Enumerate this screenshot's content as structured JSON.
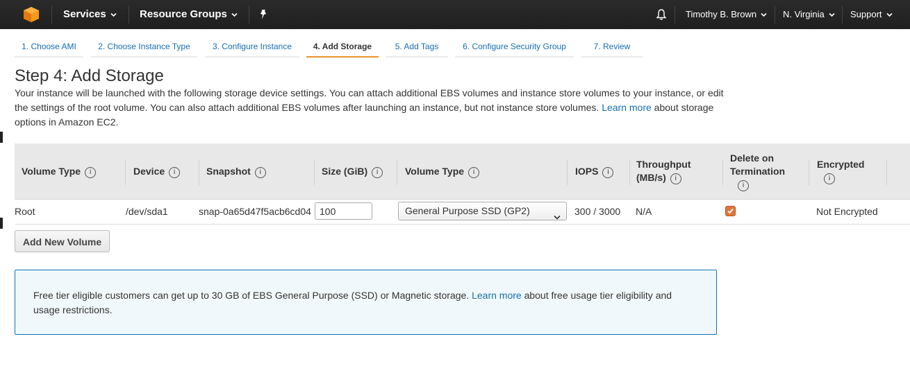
{
  "nav": {
    "services": "Services",
    "resource_groups": "Resource Groups",
    "user": "Timothy B. Brown",
    "region": "N. Virginia",
    "support": "Support",
    "logo_icon": "aws-cube-icon",
    "pin_icon": "pin-icon",
    "bell_icon": "bell-icon"
  },
  "steps": [
    {
      "label": "1. Choose AMI"
    },
    {
      "label": "2. Choose Instance Type"
    },
    {
      "label": "3. Configure Instance"
    },
    {
      "label": "4. Add Storage"
    },
    {
      "label": "5. Add Tags"
    },
    {
      "label": "6. Configure Security Group"
    },
    {
      "label": "7. Review"
    }
  ],
  "page": {
    "title": "Step 4: Add Storage",
    "desc_before": "Your instance will be launched with the following storage device settings. You can attach additional EBS volumes and instance store volumes to your instance, or edit the settings of the root volume. You can also attach additional EBS volumes after launching an instance, but not instance store volumes.",
    "learn_more": "Learn more",
    "desc_after": "about storage options in Amazon EC2."
  },
  "table": {
    "headers": {
      "volume_type": "Volume Type",
      "device": "Device",
      "snapshot": "Snapshot",
      "size": "Size (GiB)",
      "ebs_type": "Volume Type",
      "iops": "IOPS",
      "throughput_1": "Throughput",
      "throughput_2": "(MB/s)",
      "delete_1": "Delete on",
      "delete_2": "Termination",
      "encrypted": "Encrypted"
    },
    "info_glyph": "i",
    "row": {
      "volume_type": "Root",
      "device": "/dev/sda1",
      "snapshot": "snap-0a65d47f5acb6cd04",
      "size": "100",
      "ebs_type": "General Purpose SSD (GP2)",
      "iops": "300 / 3000",
      "throughput": "N/A",
      "delete_on_termination": true,
      "encrypted": "Not Encrypted"
    }
  },
  "add_volume_label": "Add New Volume",
  "infobox": {
    "text_before": "Free tier eligible customers can get up to 30 GB of EBS General Purpose (SSD) or Magnetic storage.",
    "learn_more": "Learn more",
    "text_after": "about free usage tier eligibility and usage restrictions."
  },
  "colors": {
    "nav_bg": "#232323",
    "link": "#146eb4",
    "active_tab": "#ec912d",
    "checkbox": "#e0763b",
    "infobox_border": "#0b73b7"
  }
}
